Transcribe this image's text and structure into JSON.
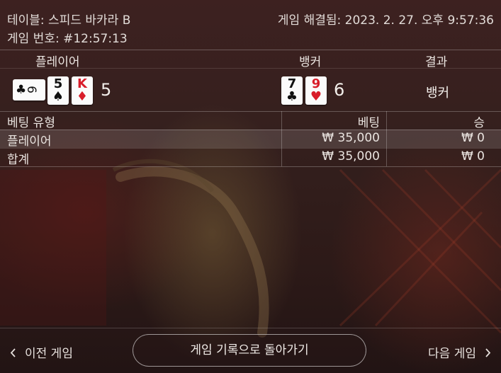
{
  "header": {
    "table_name": "테이블: 스피드 바카라 B",
    "game_number": "게임 번호: #12:57:13",
    "resolved_at": "게임 해결됨: 2023. 2. 27. 오후 9:57:36"
  },
  "result_table": {
    "player_header": "플레이어",
    "banker_header": "뱅커",
    "result_header": "결과",
    "player": {
      "score": "5",
      "cards": [
        {
          "rank": "6",
          "suit": "♣",
          "color": "black",
          "orientation": "sideways"
        },
        {
          "rank": "5",
          "suit": "♠",
          "color": "black"
        },
        {
          "rank": "K",
          "suit": "♦",
          "color": "red"
        }
      ]
    },
    "banker": {
      "score": "6",
      "cards": [
        {
          "rank": "7",
          "suit": "♣",
          "color": "black"
        },
        {
          "rank": "9",
          "suit": "♥",
          "color": "red"
        }
      ]
    },
    "result": "뱅커"
  },
  "bet_table": {
    "headers": [
      "베팅 유형",
      "베팅",
      "승"
    ],
    "rows": [
      {
        "type": "플레이어",
        "bet": "₩ 35,000",
        "win": "₩ 0"
      },
      {
        "type": "합계",
        "bet": "₩ 35,000",
        "win": "₩ 0"
      }
    ]
  },
  "footer": {
    "prev_label": "이전 게임",
    "back_label": "게임 기록으로 돌아가기",
    "next_label": "다음 게임",
    "prev_icon": "chevron-left-icon",
    "next_icon": "chevron-right-icon"
  },
  "colors": {
    "red_suit": "#d81d2a",
    "black_suit": "#111111",
    "background": "#35201e"
  }
}
